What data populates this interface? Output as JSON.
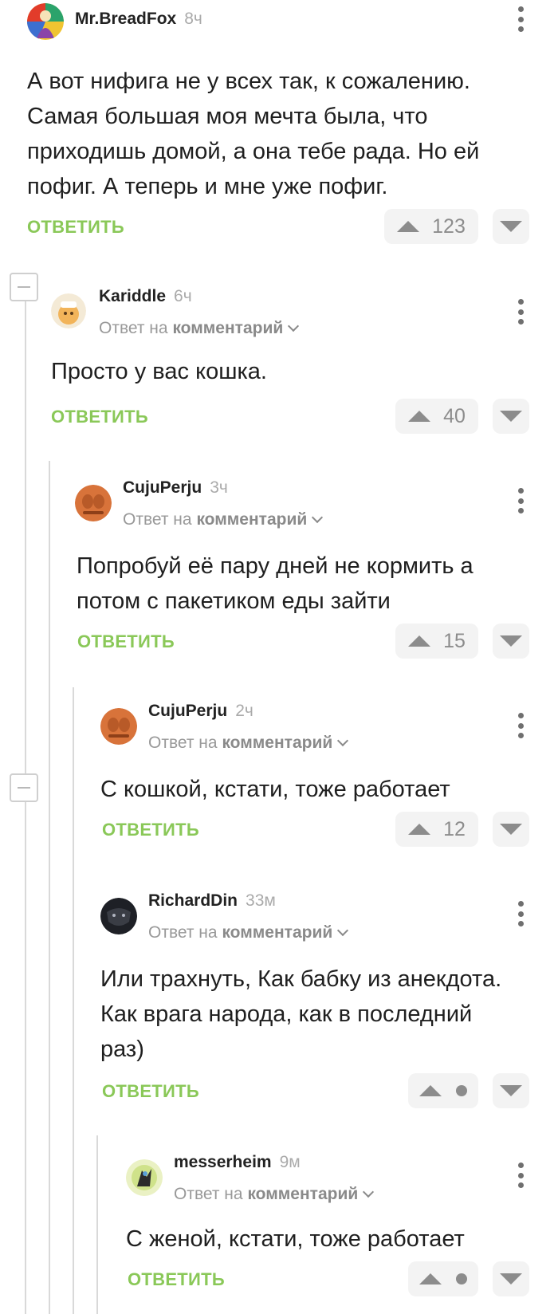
{
  "action_labels": {
    "reply": "ОТВЕТИТЬ",
    "reply_to": "Ответ на",
    "reply_to_target": "комментарий"
  },
  "colors": {
    "accent_green": "#8ac858",
    "thread_line": "#d9d9d9",
    "vote_bg": "#f3f3f3"
  },
  "comments": [
    {
      "user": "Mr.BreadFox",
      "time": "8ч",
      "text": "А вот нифига не у всех так, к сожалению. Самая большая моя мечта была, что приходишь домой, а она тебе рада. Но ей пофиг. А теперь и мне уже пофиг.",
      "score": "123"
    },
    {
      "user": "Kariddle",
      "time": "6ч",
      "text": "Просто у вас кошка.",
      "score": "40"
    },
    {
      "user": "CujuPerju",
      "time": "3ч",
      "text": "Попробуй её пару дней не кормить а потом с пакетиком еды зайти",
      "score": "15"
    },
    {
      "user": "CujuPerju",
      "time": "2ч",
      "text": "С кошкой, кстати, тоже работает",
      "score": "12"
    },
    {
      "user": "RichardDin",
      "time": "33м",
      "text": "Или трахнуть, Как бабку из анекдота. Как врага народа, как в последний раз)",
      "score": ""
    },
    {
      "user": "messerheim",
      "time": "9м",
      "text": "С женой, кстати, тоже работает",
      "score": ""
    }
  ]
}
